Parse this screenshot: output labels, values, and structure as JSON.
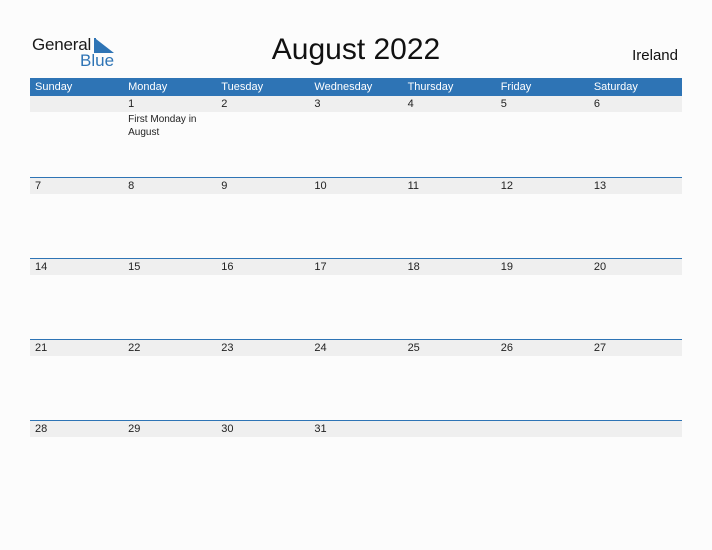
{
  "logo": {
    "general": "General",
    "blue": "Blue"
  },
  "title": "August 2022",
  "country": "Ireland",
  "colors": {
    "accent": "#2e74b5",
    "dayrow_bg": "#efefef"
  },
  "weekdays": [
    "Sunday",
    "Monday",
    "Tuesday",
    "Wednesday",
    "Thursday",
    "Friday",
    "Saturday"
  ],
  "weeks": [
    {
      "days": [
        "",
        "1",
        "2",
        "3",
        "4",
        "5",
        "6"
      ],
      "events": [
        "",
        "First Monday in August",
        "",
        "",
        "",
        "",
        ""
      ]
    },
    {
      "days": [
        "7",
        "8",
        "9",
        "10",
        "11",
        "12",
        "13"
      ],
      "events": [
        "",
        "",
        "",
        "",
        "",
        "",
        ""
      ]
    },
    {
      "days": [
        "14",
        "15",
        "16",
        "17",
        "18",
        "19",
        "20"
      ],
      "events": [
        "",
        "",
        "",
        "",
        "",
        "",
        ""
      ]
    },
    {
      "days": [
        "21",
        "22",
        "23",
        "24",
        "25",
        "26",
        "27"
      ],
      "events": [
        "",
        "",
        "",
        "",
        "",
        "",
        ""
      ]
    },
    {
      "days": [
        "28",
        "29",
        "30",
        "31",
        "",
        "",
        ""
      ],
      "events": [
        "",
        "",
        "",
        "",
        "",
        "",
        ""
      ]
    }
  ]
}
